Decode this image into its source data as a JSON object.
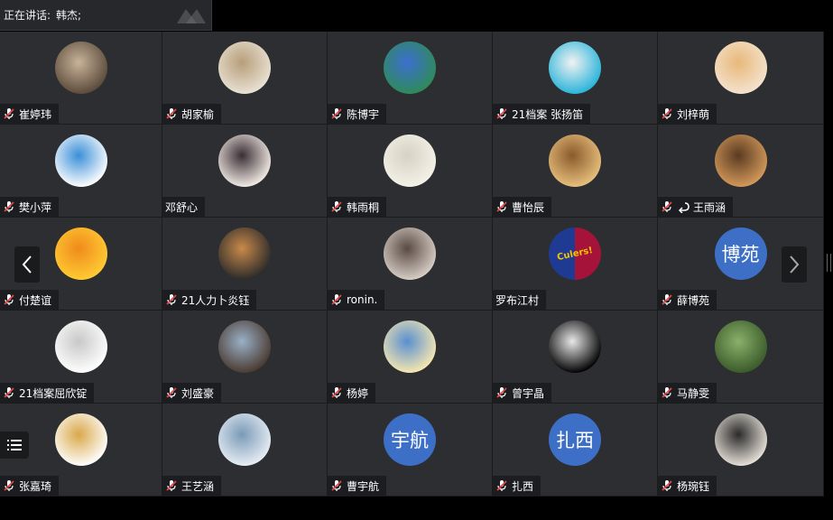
{
  "speaker": {
    "label": "正在讲话:",
    "name": "韩杰;"
  },
  "participants": [
    {
      "name": "崔婷玮",
      "muted": true,
      "avatar": {
        "kind": "photo",
        "c1": "#5a4a3a",
        "c2": "#c9b39a"
      }
    },
    {
      "name": "胡家榆",
      "muted": true,
      "avatar": {
        "kind": "photo",
        "c1": "#e9e2d4",
        "c2": "#b79e7a"
      }
    },
    {
      "name": "陈博宇",
      "muted": true,
      "avatar": {
        "kind": "photo",
        "c1": "#2e8b57",
        "c2": "#3d6fd0"
      }
    },
    {
      "name": "21档案 张扬笛",
      "muted": true,
      "avatar": {
        "kind": "photo",
        "c1": "#27b3d9",
        "c2": "#f2f2f2"
      }
    },
    {
      "name": "刘梓萌",
      "muted": true,
      "avatar": {
        "kind": "photo",
        "c1": "#f4e3cf",
        "c2": "#e8b87a"
      }
    },
    {
      "name": "樊小萍",
      "muted": true,
      "avatar": {
        "kind": "photo",
        "c1": "#ffffff",
        "c2": "#3a8fd8"
      }
    },
    {
      "name": "邓舒心",
      "muted": false,
      "avatar": {
        "kind": "photo",
        "c1": "#f3ece6",
        "c2": "#3a2e35"
      }
    },
    {
      "name": "韩雨桐",
      "muted": true,
      "avatar": {
        "kind": "photo",
        "c1": "#f4f1e8",
        "c2": "#d6d2c4"
      }
    },
    {
      "name": "曹怡辰",
      "muted": true,
      "avatar": {
        "kind": "photo",
        "c1": "#e8c07d",
        "c2": "#8a5a2b"
      }
    },
    {
      "name": "王雨涵",
      "muted": true,
      "extra_icon": "reply-icon",
      "avatar": {
        "kind": "photo",
        "c1": "#d49a5a",
        "c2": "#5a3a22"
      }
    },
    {
      "name": "付楚谊",
      "muted": true,
      "avatar": {
        "kind": "photo",
        "c1": "#ffcc33",
        "c2": "#f08a1c"
      }
    },
    {
      "name": "21人力卜炎钰",
      "muted": true,
      "avatar": {
        "kind": "photo",
        "c1": "#2a2a2a",
        "c2": "#c98a4a"
      }
    },
    {
      "name": "ronin.",
      "muted": true,
      "avatar": {
        "kind": "photo",
        "c1": "#d8cfc7",
        "c2": "#5a4a44"
      }
    },
    {
      "name": "罗布江村",
      "muted": false,
      "avatar": {
        "kind": "split",
        "c1": "#1f3a93",
        "c2": "#a5123a",
        "text": "Culers!"
      }
    },
    {
      "name": "薛博苑",
      "muted": true,
      "avatar": {
        "kind": "text",
        "color": "#3d6fc6",
        "text": "博苑"
      }
    },
    {
      "name": "21档案屈欣锭",
      "muted": true,
      "avatar": {
        "kind": "photo",
        "c1": "#ffffff",
        "c2": "#c8c8c8"
      }
    },
    {
      "name": "刘盛豪",
      "muted": true,
      "avatar": {
        "kind": "photo",
        "c1": "#4a3a30",
        "c2": "#9ab0c8"
      }
    },
    {
      "name": "杨婷",
      "muted": true,
      "avatar": {
        "kind": "photo",
        "c1": "#f7e8b0",
        "c2": "#5a8fd0"
      }
    },
    {
      "name": "曾宇晶",
      "muted": true,
      "avatar": {
        "kind": "photo",
        "c1": "#000000",
        "c2": "#e8e8e8"
      }
    },
    {
      "name": "马静雯",
      "muted": true,
      "avatar": {
        "kind": "photo",
        "c1": "#3a5a2a",
        "c2": "#8ab06a"
      }
    },
    {
      "name": "张嘉琦",
      "muted": true,
      "avatar": {
        "kind": "photo",
        "c1": "#ffffff",
        "c2": "#d9a84a"
      }
    },
    {
      "name": "王艺涵",
      "muted": true,
      "avatar": {
        "kind": "photo",
        "c1": "#e8eef4",
        "c2": "#7a9ab8"
      }
    },
    {
      "name": "曹宇航",
      "muted": true,
      "avatar": {
        "kind": "text",
        "color": "#3d6fc6",
        "text": "宇航"
      }
    },
    {
      "name": "扎西",
      "muted": true,
      "avatar": {
        "kind": "text",
        "color": "#3d6fc6",
        "text": "扎西"
      }
    },
    {
      "name": "杨琬钰",
      "muted": true,
      "avatar": {
        "kind": "photo",
        "c1": "#e8e2da",
        "c2": "#2a2a2a"
      }
    }
  ],
  "colors": {
    "tile_bg": "#2c2e32",
    "nametag_bg": "#1c1d20",
    "mic_muted": "#e04848",
    "text_avatar": "#3d6fc6"
  },
  "icons": {
    "prev": "chevron-left-icon",
    "next": "chevron-right-icon",
    "menu": "list-menu-icon",
    "mic": "mic-muted-icon"
  }
}
